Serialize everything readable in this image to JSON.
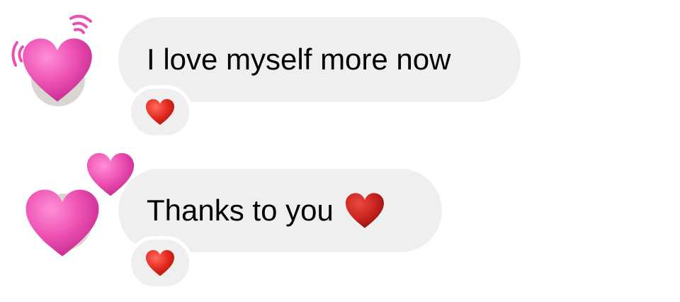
{
  "messages": [
    {
      "text": "I love myself more now",
      "avatar_icon": "beating-heart-icon",
      "reaction_icon": "red-heart-icon"
    },
    {
      "text": "Thanks to you",
      "inline_icon": "red-heart-icon",
      "avatar_icon": "two-hearts-icon",
      "reaction_icon": "red-heart-icon"
    }
  ],
  "colors": {
    "bubble_background": "#efefef",
    "text": "#000000",
    "pink_heart": "#ec4fb2",
    "red_heart": "#e0281e",
    "dark_red_heart": "#c8231e"
  }
}
